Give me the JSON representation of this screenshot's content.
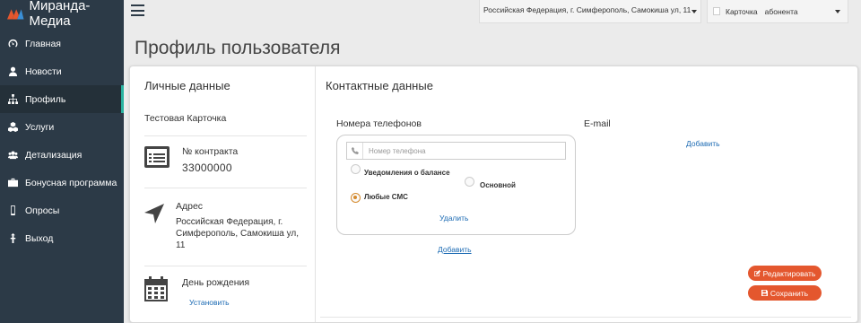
{
  "app": {
    "brand": "Миранда-Медиа"
  },
  "sidebar": {
    "items": [
      {
        "label": "Главная",
        "icon": "dashboard-icon"
      },
      {
        "label": "Новости",
        "icon": "user-icon"
      },
      {
        "label": "Профиль",
        "icon": "sitemap-icon",
        "active": true
      },
      {
        "label": "Услуги",
        "icon": "cubes-icon"
      },
      {
        "label": "Детализация",
        "icon": "users-icon"
      },
      {
        "label": "Бонусная программа",
        "icon": "briefcase-icon"
      },
      {
        "label": "Опросы",
        "icon": "mobile-icon"
      },
      {
        "label": "Выход",
        "icon": "logout-icon"
      }
    ]
  },
  "topbar": {
    "address_select": "Российская Федерация, г. Симферополь, Самокиша ул, 11",
    "card_label": "Карточка",
    "card_value": "абонента"
  },
  "page": {
    "title": "Профиль пользователя"
  },
  "personal": {
    "title": "Личные данные",
    "name": "Тестовая Карточка",
    "contract_label": "№ контракта",
    "contract_value": "33000000",
    "address_label": "Адрес",
    "address_value": "Российская Федерация, г. Симферополь, Самокиша ул, 11",
    "birthday_label": "День рождения",
    "birthday_action": "Установить"
  },
  "contacts": {
    "title": "Контактные данные",
    "phones_label": "Номера телефонов",
    "phone_placeholder": "Номер телефона",
    "radio_balance": "Уведомления о балансе",
    "radio_main": "Основной",
    "radio_sms": "Любые СМС",
    "delete_label": "Удалить",
    "add_phone_label": "Добавить",
    "email_label": "E-mail",
    "add_email_label": "Добавить",
    "edit_button": "Редактировать",
    "save_button": "Сохранить"
  },
  "colors": {
    "sidebar": "#2c3a47",
    "accent": "#2ab3a0",
    "button": "#e4572e",
    "link": "#1b6ab3"
  }
}
